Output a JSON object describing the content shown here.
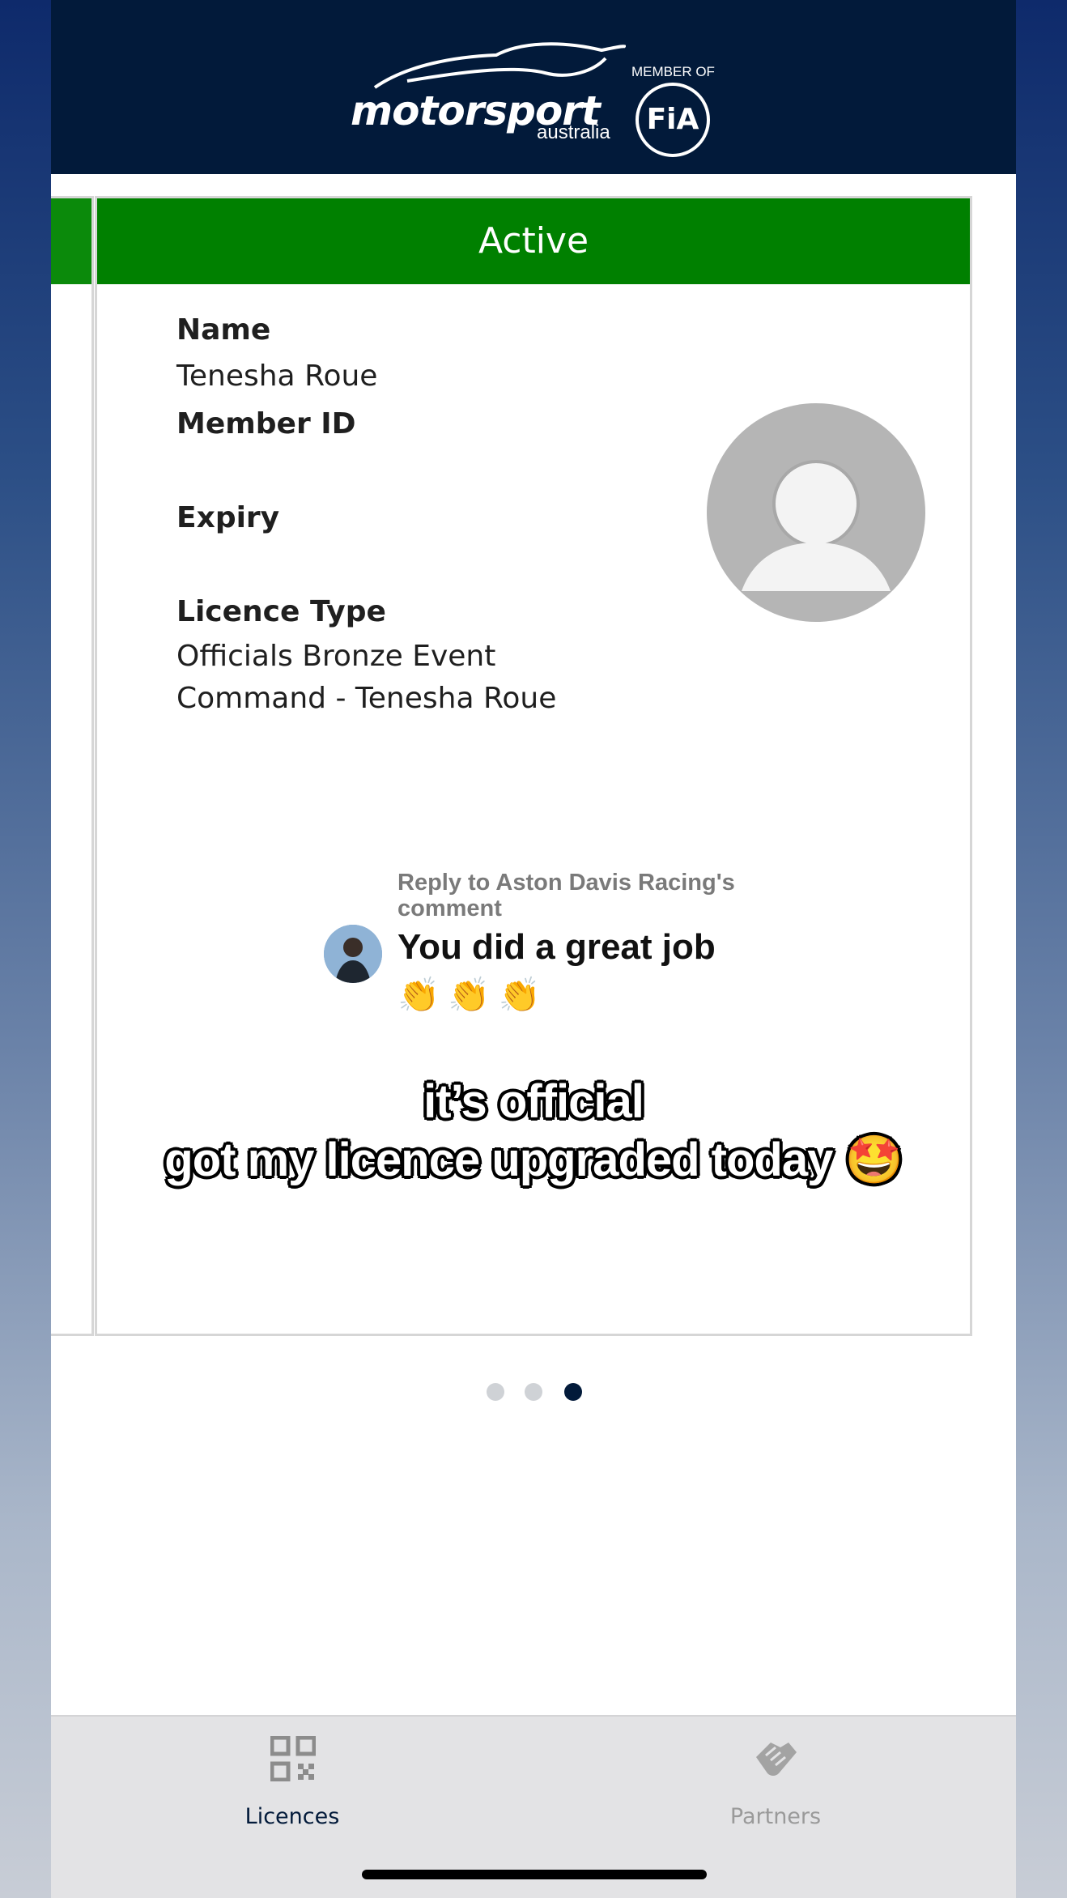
{
  "header": {
    "brand": "motorsport",
    "brand_sub": "australia",
    "member_of": "MEMBER OF",
    "fia": "FiA"
  },
  "licence_card": {
    "status": "Active",
    "status_color": "#008000",
    "name_label": "Name",
    "name_value": "Tenesha Roue",
    "member_id_label": "Member ID",
    "member_id_value": "",
    "expiry_label": "Expiry",
    "expiry_value": "",
    "licence_type_label": "Licence Type",
    "licence_type_line1": "Officials Bronze Event",
    "licence_type_line2": "Command - Tenesha Roue",
    "avatar_icon": "default-profile-icon"
  },
  "overlay": {
    "reply_title": "Reply to Aston Davis Racing's comment",
    "reply_text": "You did a great job",
    "reply_emoji": "👏👏👏",
    "caption_line1": "it’s official",
    "caption_line2": "got my licence upgraded today 🤩"
  },
  "pagination": {
    "total": 3,
    "active_index": 3
  },
  "tabbar": {
    "tabs": [
      {
        "label": "Licences",
        "icon": "qr-code-icon",
        "active": true
      },
      {
        "label": "Partners",
        "icon": "handshake-icon",
        "active": false
      }
    ],
    "active_color": "#021a3a",
    "inactive_color": "#9a9a9a"
  }
}
